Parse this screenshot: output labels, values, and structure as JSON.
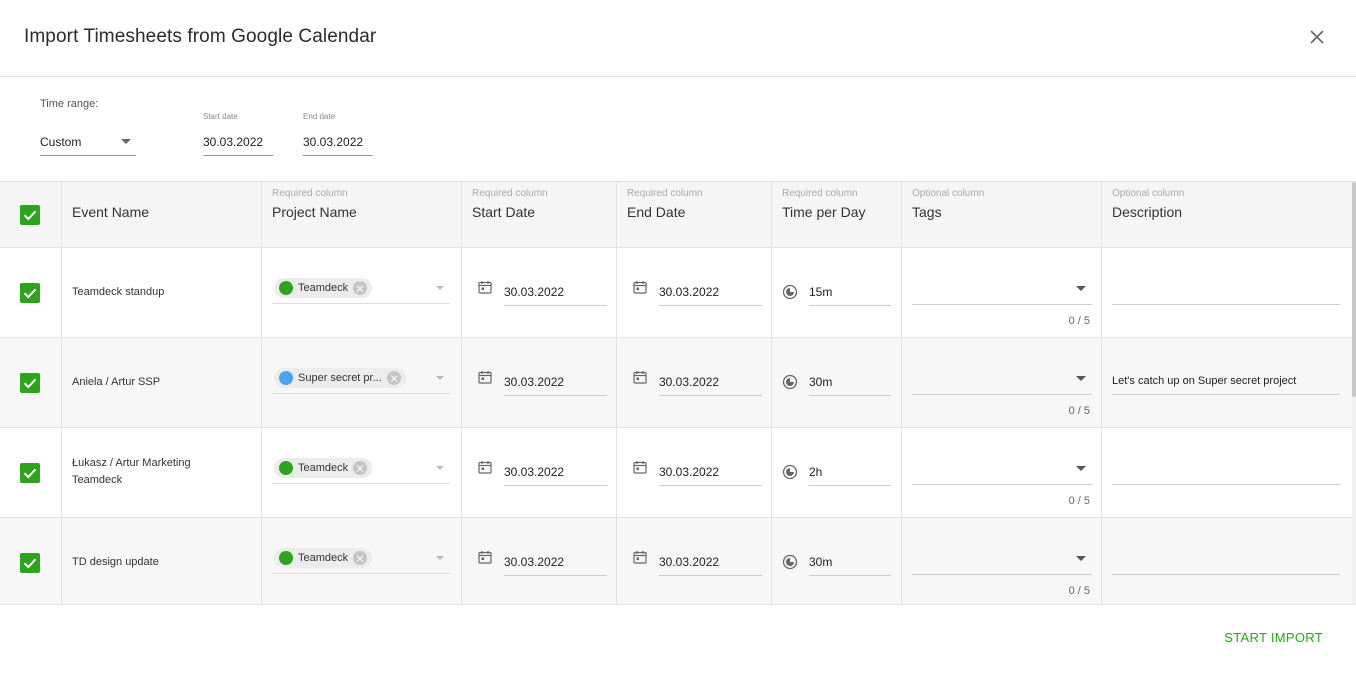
{
  "dialog": {
    "title": "Import Timesheets from Google Calendar"
  },
  "filters": {
    "time_range_label": "Time range:",
    "time_range_value": "Custom",
    "start_date_label": "Start date",
    "start_date_value": "30.03.2022",
    "end_date_label": "End date",
    "end_date_value": "30.03.2022"
  },
  "columns": [
    {
      "hint": "",
      "name": "Event Name"
    },
    {
      "hint": "Required column",
      "name": "Project Name"
    },
    {
      "hint": "Required column",
      "name": "Start Date"
    },
    {
      "hint": "Required column",
      "name": "End Date"
    },
    {
      "hint": "Required column",
      "name": "Time per Day"
    },
    {
      "hint": "Optional column",
      "name": "Tags"
    },
    {
      "hint": "Optional column",
      "name": "Description"
    }
  ],
  "rows": [
    {
      "event_line1": "Teamdeck standup",
      "event_line2": "",
      "project": "Teamdeck",
      "project_color": "#2ea31d",
      "start": "30.03.2022",
      "end": "30.03.2022",
      "time": "15m",
      "tags_count": "0 / 5",
      "description": ""
    },
    {
      "event_line1": "Aniela / Artur SSP",
      "event_line2": "",
      "project": "Super secret pr...",
      "project_color": "#4aa3f0",
      "start": "30.03.2022",
      "end": "30.03.2022",
      "time": "30m",
      "tags_count": "0 / 5",
      "description": "Let's catch up on Super secret project"
    },
    {
      "event_line1": "Łukasz / Artur Marketing",
      "event_line2": "Teamdeck",
      "project": "Teamdeck",
      "project_color": "#2ea31d",
      "start": "30.03.2022",
      "end": "30.03.2022",
      "time": "2h",
      "tags_count": "0 / 5",
      "description": ""
    },
    {
      "event_line1": "TD design update",
      "event_line2": "",
      "project": "Teamdeck",
      "project_color": "#2ea31d",
      "start": "30.03.2022",
      "end": "30.03.2022",
      "time": "30m",
      "tags_count": "0 / 5",
      "description": ""
    }
  ],
  "footer": {
    "start_import_label": "START IMPORT"
  },
  "colors": {
    "accent": "#2ea31d",
    "secondary_project": "#4aa3f0"
  },
  "icons": [
    "close-icon",
    "caret-down-icon",
    "checkbox-checked-icon",
    "calendar-icon",
    "clock-icon",
    "chip-remove-icon"
  ]
}
